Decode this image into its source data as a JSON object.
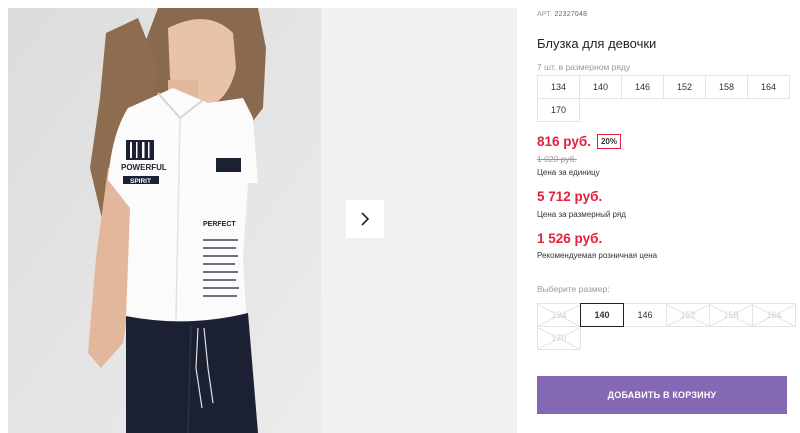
{
  "product": {
    "article_label": "АРТ.",
    "article": "22327048",
    "title": "Блузка для девочки",
    "series_note": "7 шт. в размерном ряду",
    "series_sizes": [
      "134",
      "140",
      "146",
      "152",
      "158",
      "164",
      "170"
    ],
    "price_unit": "816 руб.",
    "discount": "20%",
    "price_old": "1 020 руб.",
    "price_unit_caption": "Цена за единицу",
    "price_series": "5 712 руб.",
    "price_series_caption": "Цена за размерный ряд",
    "price_retail": "1 526 руб.",
    "price_retail_caption": "Рекомендуемая розничная цена",
    "choose_label": "Выберите размер:",
    "size_options": [
      {
        "label": "134",
        "state": "unavailable"
      },
      {
        "label": "140",
        "state": "selected"
      },
      {
        "label": "146",
        "state": "available"
      },
      {
        "label": "152",
        "state": "unavailable"
      },
      {
        "label": "158",
        "state": "unavailable"
      },
      {
        "label": "164",
        "state": "unavailable"
      },
      {
        "label": "170",
        "state": "unavailable"
      }
    ],
    "add_to_cart": "ДОБАВИТЬ В КОРЗИНУ"
  },
  "shirt_print": {
    "text_powerful": "POWERFUL",
    "text_spirit": "SPIRIT",
    "text_perfect": "PERFECT"
  },
  "colors": {
    "price_red": "#e3213b",
    "button_purple": "#8468b3",
    "skirt_navy": "#1b2132"
  },
  "icons": [
    "chevron-right-icon"
  ]
}
